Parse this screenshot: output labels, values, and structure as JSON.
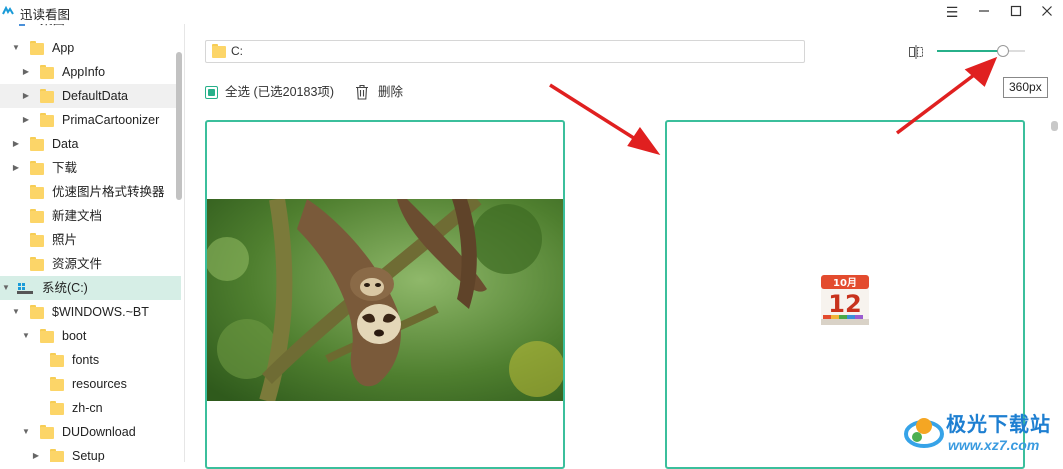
{
  "window": {
    "title": "迅读看图",
    "controls": [
      "menu-icon",
      "minimize-icon",
      "maximize-icon",
      "close-icon"
    ]
  },
  "sidebar": {
    "partial_top_label": "桌面",
    "items": [
      {
        "label": "App",
        "expanded": true,
        "type": "folder"
      },
      {
        "label": "AppInfo",
        "expanded": false,
        "type": "folder"
      },
      {
        "label": "DefaultData",
        "expanded": false,
        "type": "folder"
      },
      {
        "label": "PrimaCartoonizer",
        "expanded": false,
        "type": "folder"
      },
      {
        "label": "Data",
        "expanded": false,
        "type": "folder"
      },
      {
        "label": "下载",
        "expanded": false,
        "type": "folder"
      },
      {
        "label": "优速图片格式转换器",
        "type": "folder"
      },
      {
        "label": "新建文档",
        "type": "folder"
      },
      {
        "label": "照片",
        "type": "folder"
      },
      {
        "label": "资源文件",
        "type": "folder"
      },
      {
        "label": "系统(C:)",
        "expanded": true,
        "type": "drive"
      },
      {
        "label": "$WINDOWS.~BT",
        "expanded": true,
        "type": "folder"
      },
      {
        "label": "boot",
        "expanded": true,
        "type": "folder"
      },
      {
        "label": "fonts",
        "type": "folder"
      },
      {
        "label": "resources",
        "type": "folder"
      },
      {
        "label": "zh-cn",
        "type": "folder"
      },
      {
        "label": "DUDownload",
        "expanded": true,
        "type": "folder"
      },
      {
        "label": "Setup",
        "expanded": false,
        "type": "folder"
      }
    ]
  },
  "path_bar": {
    "value": "C:"
  },
  "zoom": {
    "tooltip": "360px",
    "level": 0.75
  },
  "toolbar": {
    "select_all_label": "全选 (已选20183项)",
    "delete_label": "删除"
  },
  "thumbnails": [
    {
      "kind": "photo",
      "subject": "sloth"
    },
    {
      "kind": "app-icon",
      "icon": "calendar-icon",
      "month": "10月",
      "day": "12"
    }
  ],
  "watermark": {
    "title": "极光下载站",
    "url": "www.xz7.com"
  },
  "colors": {
    "accent": "#27b08a",
    "card_border": "#3bbf9c",
    "selected_row": "#d6eee6",
    "annotation_arrow": "#e02020"
  }
}
